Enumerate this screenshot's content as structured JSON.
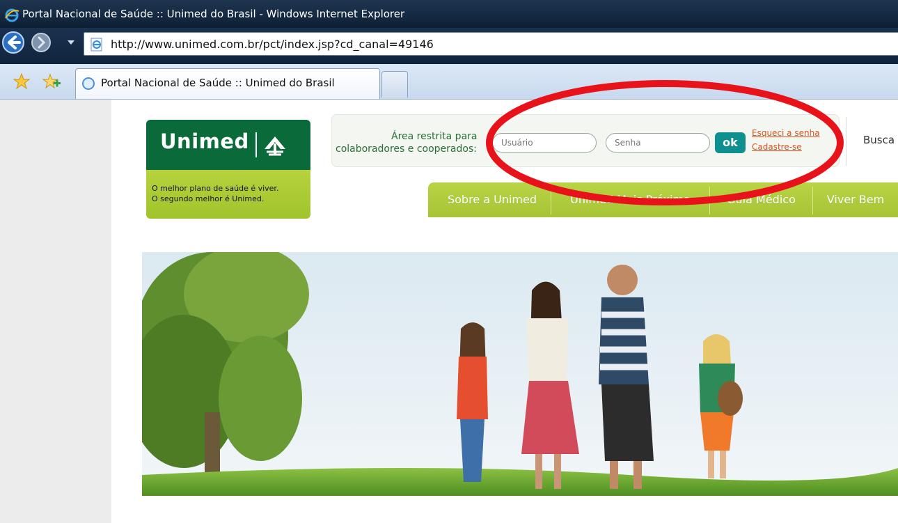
{
  "window": {
    "title": "Portal Nacional de Saúde :: Unimed do Brasil - Windows Internet Explorer"
  },
  "address_bar": {
    "url": "http://www.unimed.com.br/pct/index.jsp?cd_canal=49146"
  },
  "tabs": [
    {
      "label": "Portal Nacional de Saúde :: Unimed do Brasil",
      "active": true
    }
  ],
  "logo": {
    "brand": "Unimed",
    "tagline_line1": "O melhor plano de saúde é viver.",
    "tagline_line2": "O segundo melhor é Unimed."
  },
  "login": {
    "label_line1": "Área restrita para",
    "label_line2": "colaboradores e cooperados:",
    "user_placeholder": "Usuário",
    "password_placeholder": "Senha",
    "ok_label": "ok",
    "forgot_link": "Esqueci a senha",
    "register_link": "Cadastre-se"
  },
  "search": {
    "label": "Busca"
  },
  "main_nav": {
    "items": [
      "Sobre a Unimed",
      "Unimed Mais Próxima",
      "Guia Médico",
      "Viver Bem"
    ]
  },
  "colors": {
    "unimed_green": "#0a6a3a",
    "lime": "#a6c435",
    "link_orange": "#d9531e",
    "ok_teal": "#0e8f90",
    "annotation_red": "#e8121b"
  }
}
